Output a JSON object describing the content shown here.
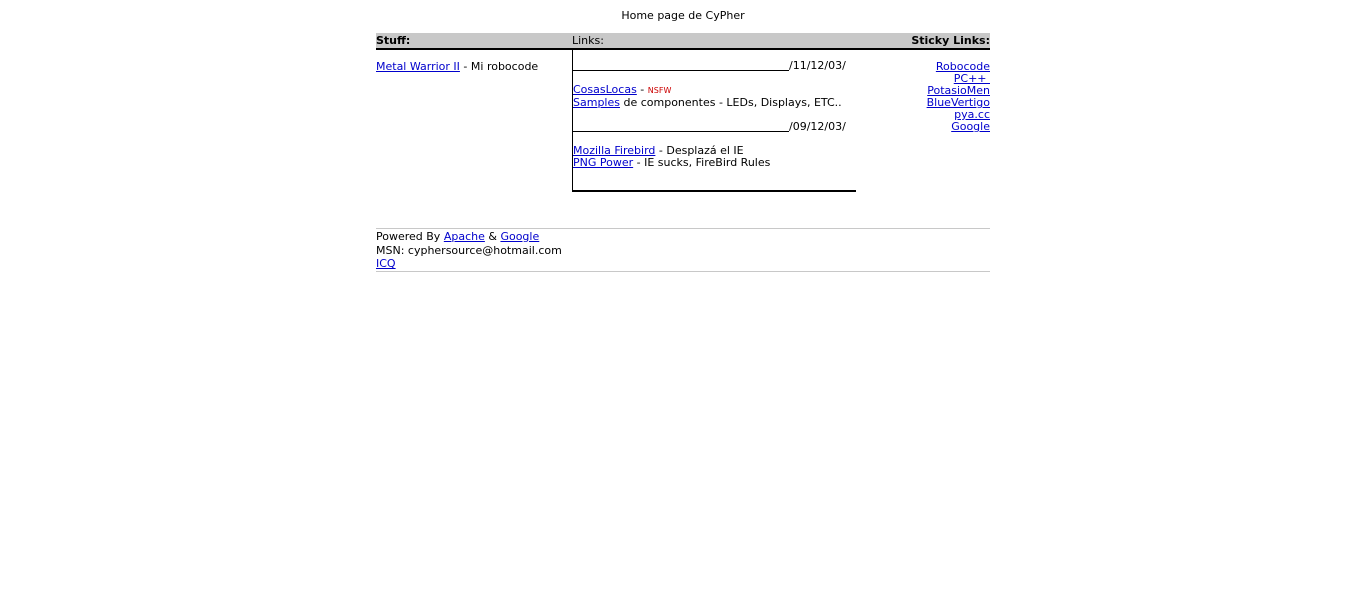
{
  "title": "Home page de CyPher",
  "header": {
    "stuff": "Stuff:",
    "links": "Links:",
    "sticky": "Sticky Links:"
  },
  "stuff": {
    "link": "Metal Warrior II",
    "desc": " - Mi robocode"
  },
  "links": {
    "date1": "/11/12/03/",
    "cosas_link": "CosasLocas",
    "cosas_sep": " - ",
    "nsfw": "NSFW",
    "samples_link": "Samples",
    "samples_desc": " de componentes - LEDs, Displays, ETC..",
    "date2": "/09/12/03/",
    "firebird_link": "Mozilla Firebird",
    "firebird_desc": " - Desplazá el IE",
    "png_link": "PNG Power",
    "png_desc": " - IE sucks, FireBird Rules"
  },
  "sticky": [
    "Robocode",
    "PC++ ",
    "PotasioMen",
    "BlueVertigo",
    "pya.cc",
    "Google"
  ],
  "footer": {
    "powered": "Powered By ",
    "apache": "Apache",
    "amp": " & ",
    "google": "Google",
    "msn": "MSN: cyphersource@hotmail.com",
    "icq": "ICQ"
  },
  "colors": {
    "header_bg": "#c8c8c8",
    "link": "#0000cc",
    "nsfw": "#cc0000"
  }
}
